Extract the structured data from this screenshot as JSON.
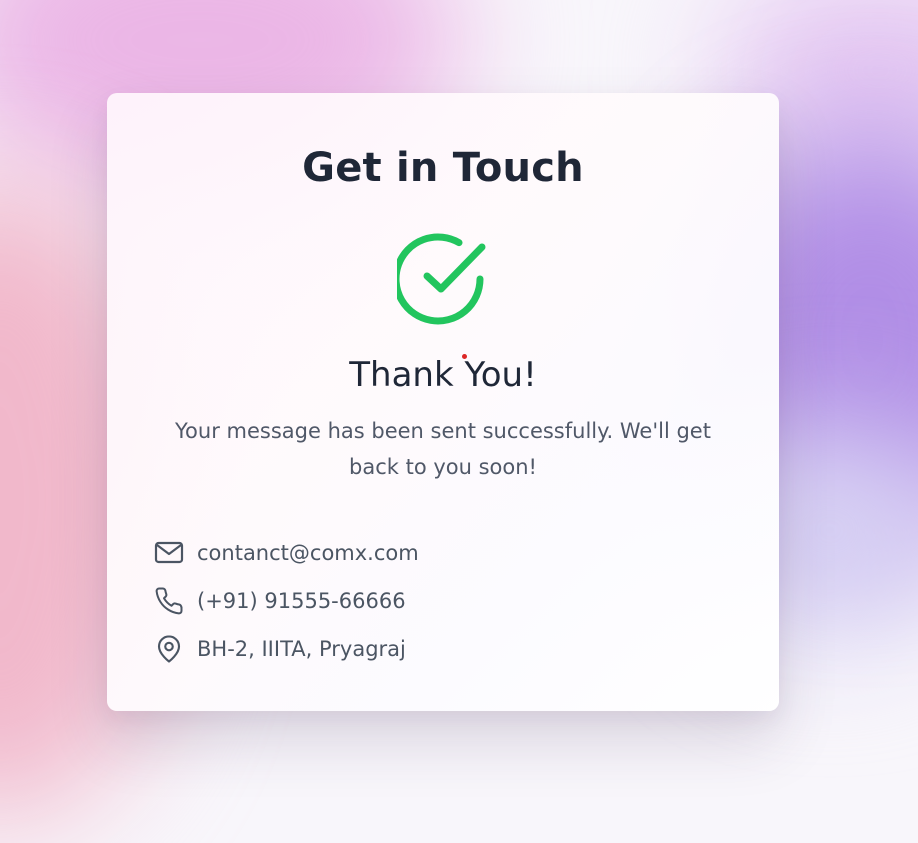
{
  "card": {
    "title": "Get in Touch",
    "success_heading": "Thank You!",
    "success_message": "Your message has been sent successfully. We'll get back to you soon!"
  },
  "contacts": [
    {
      "icon": "mail-icon",
      "text": "contanct@comx.com"
    },
    {
      "icon": "phone-icon",
      "text": "(+91) 91555-66666"
    },
    {
      "icon": "map-pin-icon",
      "text": "BH-2, IIITA, Pryagraj"
    }
  ],
  "icons": {
    "success": "check-circle-icon"
  },
  "colors": {
    "success_green": "#22c55e",
    "heading": "#1f2737",
    "body_text": "#4b5563",
    "icon_stroke": "#4b5563"
  }
}
